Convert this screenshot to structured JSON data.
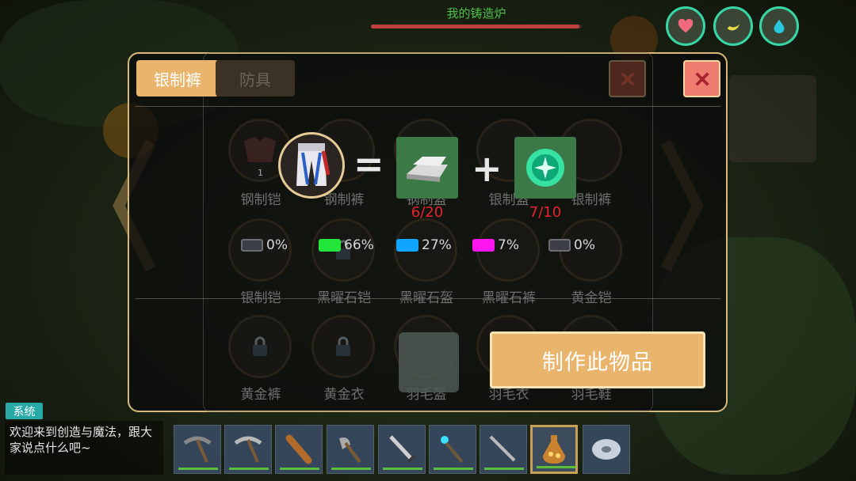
{
  "top_bar": {
    "furnace_title": "我的铸造炉",
    "furnace_progress": 0.99,
    "status_icons": [
      "heart-icon",
      "hunger-icon",
      "water-icon"
    ]
  },
  "tabs": [
    {
      "label": "银制裤",
      "active": true
    },
    {
      "label": "防具",
      "active": false
    }
  ],
  "grid": {
    "row1": [
      {
        "name": "钢制铠",
        "count": "1"
      },
      {
        "name": "钢制裤",
        "count": ""
      },
      {
        "name": "钢制盔",
        "count": ""
      },
      {
        "name": "银制盔",
        "count": ""
      },
      {
        "name": "银制裤",
        "count": ""
      }
    ],
    "row2": [
      {
        "name": "银制铠"
      },
      {
        "name": "黑曜石铠"
      },
      {
        "name": "黑曜石盔"
      },
      {
        "name": "黑曜石裤"
      },
      {
        "name": "黄金铠"
      }
    ],
    "row3": [
      {
        "name": "黄金裤"
      },
      {
        "name": "黄金衣"
      },
      {
        "name": "羽毛盔"
      },
      {
        "name": "羽毛衣"
      },
      {
        "name": "羽毛鞋"
      }
    ]
  },
  "recipe": {
    "result": "银制裤",
    "equals": "=",
    "plus": "+",
    "materials": [
      {
        "icon": "silver-ingot-icon",
        "count": "6/20"
      },
      {
        "icon": "green-gem-icon",
        "count": "7/10"
      }
    ]
  },
  "quality_chances": [
    {
      "color": "#3b3f45",
      "value": "0%"
    },
    {
      "color": "#22e63a",
      "value": "66%"
    },
    {
      "color": "#10a5ff",
      "value": "27%"
    },
    {
      "color": "#ff16f0",
      "value": "7%"
    },
    {
      "color": "#3b3f45",
      "value": "0%"
    }
  ],
  "craft_button": "制作此物品",
  "chat": {
    "badge": "系统",
    "message": "欢迎来到创造与魔法，跟大家说点什么吧~"
  },
  "hotbar": [
    {
      "icon": "pickaxe-stone-icon",
      "selected": false
    },
    {
      "icon": "pickaxe-iron-icon",
      "selected": false
    },
    {
      "icon": "club-icon",
      "selected": false
    },
    {
      "icon": "axe-icon",
      "selected": false
    },
    {
      "icon": "sword-icon",
      "selected": false
    },
    {
      "icon": "magic-staff-icon",
      "selected": false
    },
    {
      "icon": "long-sword-icon",
      "selected": false
    },
    {
      "icon": "flask-icon",
      "selected": true
    },
    {
      "icon": "disc-icon",
      "selected": false
    }
  ]
}
